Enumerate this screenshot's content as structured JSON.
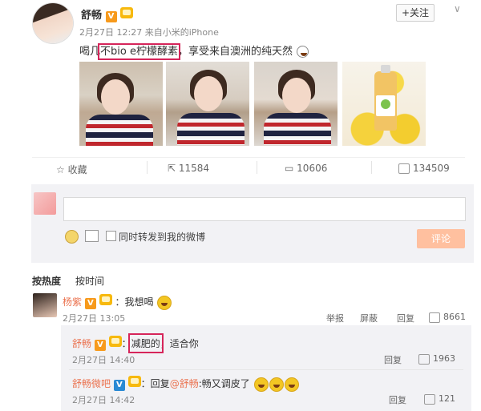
{
  "post": {
    "author": "舒畅",
    "v_badge": "V",
    "follow_label": "+关注",
    "time": "2月27日 12:27",
    "source": "来自小米的iPhone",
    "text_before": "喝几",
    "text_highlight": "不bio e柠檬酵素",
    "text_after": "，享受来自澳洲的纯天然",
    "actions": {
      "favorite": "收藏",
      "repost_count": "11584",
      "comment_count": "10606",
      "like_count": "134509"
    }
  },
  "composer": {
    "sync_label": "同时转发到我的微博",
    "submit_label": "评论"
  },
  "sort_tabs": [
    "按热度",
    "按时间"
  ],
  "comments": [
    {
      "author": "杨紫",
      "v_badge": "V",
      "text": "：我想喝",
      "time": "2月27日 13:05",
      "ops": [
        "举报",
        "屏蔽",
        "回复"
      ],
      "likes": "8661"
    }
  ],
  "replies": [
    {
      "author": "舒畅",
      "v_badge": "V",
      "text_highlight": "减肥的",
      "text_after": "，适合你",
      "time": "2月27日 14:40",
      "reply_label": "回复",
      "likes": "1963"
    },
    {
      "author": "舒畅微吧",
      "v_badge": "V",
      "text_before": "：回复",
      "mention": "@舒畅",
      "text_after": ":畅又调皮了",
      "time": "2月27日 14:42",
      "reply_label": "回复",
      "likes": "121"
    }
  ],
  "colors": {
    "highlight_box": "#d6255a",
    "name_orange": "#eb7350",
    "submit_bg": "#ffc09f"
  }
}
